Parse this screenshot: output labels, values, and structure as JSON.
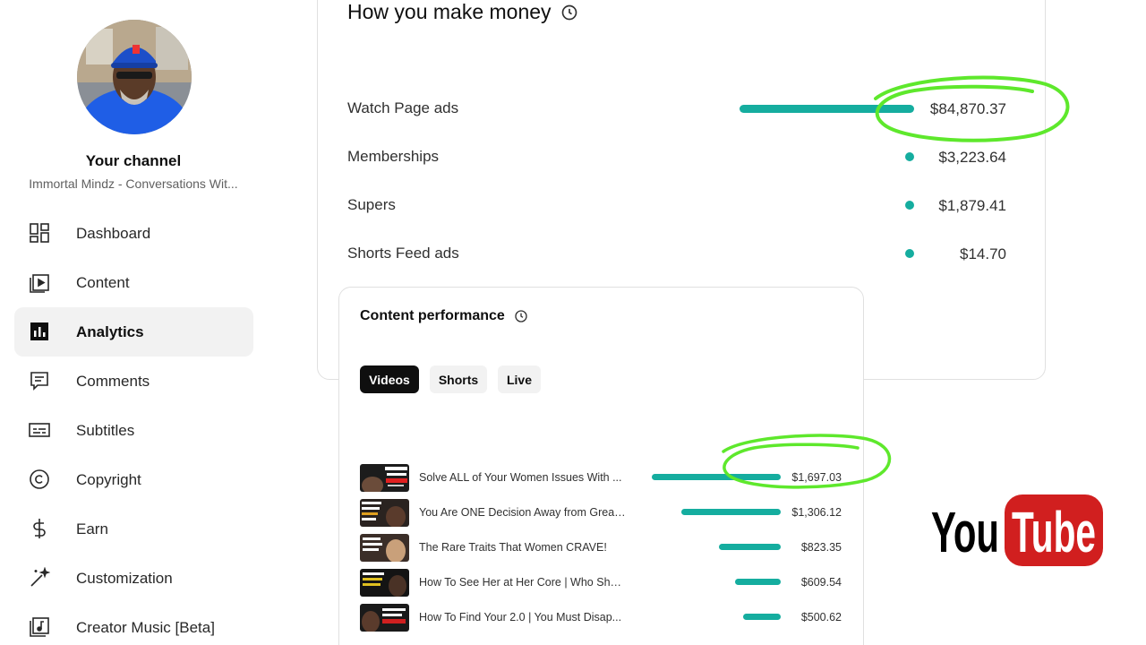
{
  "sidebar": {
    "channel_title": "Your channel",
    "channel_name": "Immortal Mindz - Conversations Wit...",
    "items": [
      {
        "label": "Dashboard",
        "icon": "dashboard-icon"
      },
      {
        "label": "Content",
        "icon": "content-icon"
      },
      {
        "label": "Analytics",
        "icon": "analytics-icon",
        "active": true
      },
      {
        "label": "Comments",
        "icon": "comments-icon"
      },
      {
        "label": "Subtitles",
        "icon": "subtitles-icon"
      },
      {
        "label": "Copyright",
        "icon": "copyright-icon"
      },
      {
        "label": "Earn",
        "icon": "earn-icon"
      },
      {
        "label": "Customization",
        "icon": "customization-icon"
      },
      {
        "label": "Creator Music [Beta]",
        "icon": "creator-music-icon"
      }
    ]
  },
  "revenue": {
    "title": "How you make money",
    "rows": [
      {
        "label": "Watch Page ads",
        "value": "$84,870.37",
        "amount": 84870.37
      },
      {
        "label": "Memberships",
        "value": "$3,223.64",
        "amount": 3223.64
      },
      {
        "label": "Supers",
        "value": "$1,879.41",
        "amount": 1879.41
      },
      {
        "label": "Shorts Feed ads",
        "value": "$14.70",
        "amount": 14.7
      }
    ]
  },
  "content_performance": {
    "title": "Content performance",
    "tabs": [
      "Videos",
      "Shorts",
      "Live"
    ],
    "active_tab": "Videos",
    "videos": [
      {
        "title": "Solve ALL of Your Women Issues With ...",
        "value": "$1,697.03",
        "amount": 1697.03,
        "thumb_text": "FIX YOUR \"WOMEN ISSUES\" FOREVER"
      },
      {
        "title": "You Are ONE Decision Away from Great...",
        "value": "$1,306.12",
        "amount": 1306.12,
        "thumb_text": "YOU'RE AT THE POINT OF NO RETURN"
      },
      {
        "title": "The Rare Traits That Women CRAVE!",
        "value": "$823.35",
        "amount": 823.35,
        "thumb_text": "7 TRAITS THAT DRIVE HER CRAZY"
      },
      {
        "title": "How To See Her at Her Core | Who She ...",
        "value": "$609.54",
        "amount": 609.54,
        "thumb_text": "STOP IGNORING WHO SHE REALLY IS"
      },
      {
        "title": "How To Find Your 2.0 | You Must Disap...",
        "value": "$500.62",
        "amount": 500.62,
        "thumb_text": "DARE YOU TO DISAPPEAR"
      }
    ]
  },
  "brand": {
    "logo_text_left": "You",
    "logo_text_right": "Tube",
    "accent_color": "#15ad9f",
    "highlight_color": "#5ee82c",
    "logo_red": "#d11f1f"
  }
}
